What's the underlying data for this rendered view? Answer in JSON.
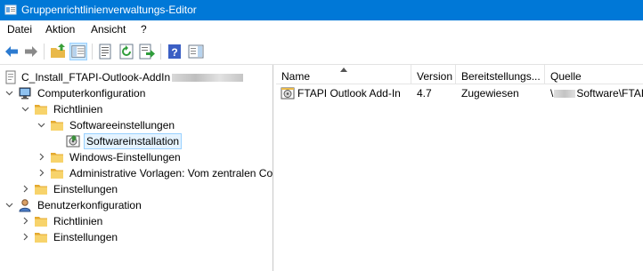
{
  "window": {
    "title": "Gruppenrichtlinienverwaltungs-Editor"
  },
  "menu": [
    "Datei",
    "Aktion",
    "Ansicht",
    "?"
  ],
  "toolbar": {
    "buttons": [
      "back-arrow-icon",
      "forward-arrow-icon",
      "up-folder-icon",
      "show-hide-tree-icon",
      "properties-icon",
      "refresh-icon",
      "export-list-icon",
      "help-icon",
      "action-pane-icon"
    ]
  },
  "tree": {
    "root": {
      "label": "C_Install_FTAPI-Outlook-AddIn"
    },
    "computer_config": {
      "label": "Computerkonfiguration"
    },
    "policies": {
      "label": "Richtlinien"
    },
    "software_settings": {
      "label": "Softwareeinstellungen"
    },
    "software_installation": {
      "label": "Softwareinstallation"
    },
    "windows_settings": {
      "label": "Windows-Einstellungen"
    },
    "admin_templates": {
      "label": "Administrative Vorlagen: Vom zentralen Co"
    },
    "preferences": {
      "label": "Einstellungen"
    },
    "user_config": {
      "label": "Benutzerkonfiguration"
    },
    "user_policies": {
      "label": "Richtlinien"
    },
    "user_preferences": {
      "label": "Einstellungen"
    }
  },
  "list": {
    "columns": [
      "Name",
      "Version",
      "Bereitstellungs...",
      "Quelle"
    ],
    "rows": [
      {
        "name": "FTAPI Outlook Add-In",
        "version": "4.7",
        "deployment": "Zugewiesen",
        "source_prefix": "\\",
        "source_suffix": "Software\\FTAI"
      }
    ]
  },
  "colors": {
    "titlebar": "#0078d7",
    "folder": "#f2c55c",
    "selection": "#e5f3ff"
  }
}
